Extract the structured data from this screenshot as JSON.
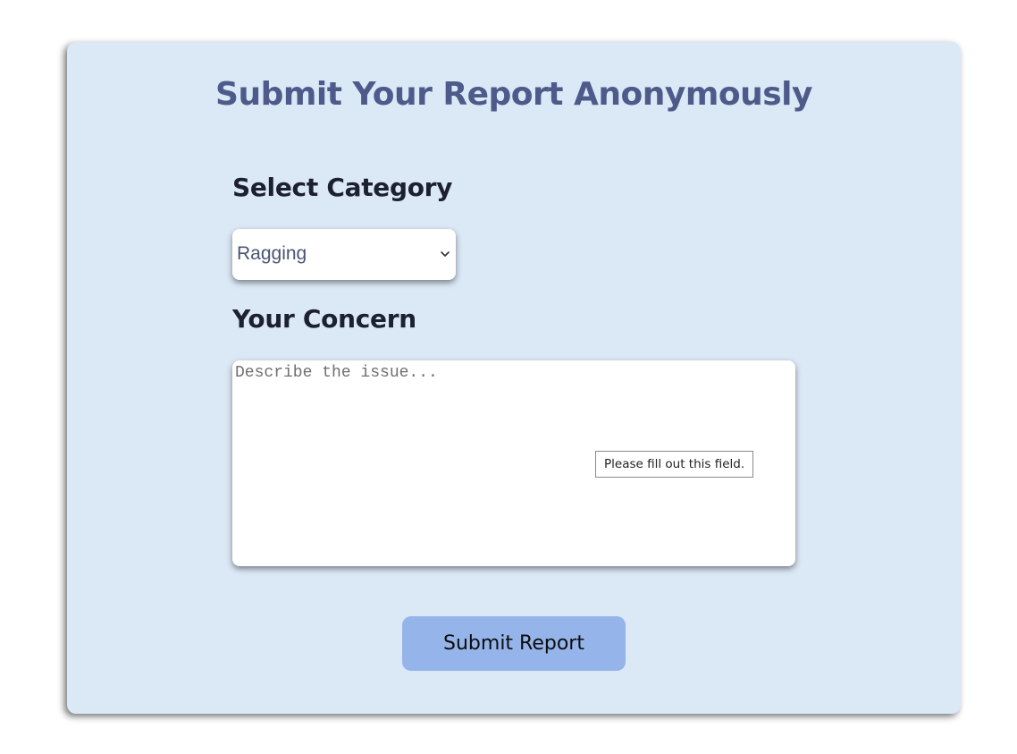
{
  "form": {
    "title": "Submit Your Report Anonymously",
    "category_label": "Select Category",
    "category_selected": "Ragging",
    "concern_label": "Your Concern",
    "concern_value": "",
    "concern_placeholder": "Describe the issue...",
    "validation_message": "Please fill out this field.",
    "submit_label": "Submit Report"
  },
  "colors": {
    "card_background": "#dbe8f6",
    "title": "#4e5a8a",
    "submit_button": "#94b4ea"
  },
  "icons": {
    "select_chevron": "chevron-down-icon"
  }
}
